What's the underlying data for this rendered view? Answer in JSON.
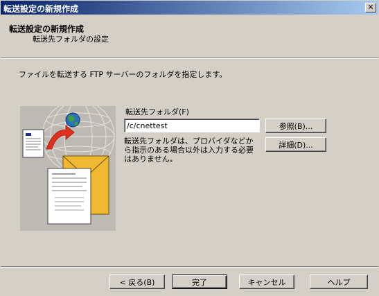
{
  "window": {
    "title": "転送設定の新規作成",
    "close_label": "✕"
  },
  "header": {
    "title": "転送設定の新規作成",
    "subtitle": "転送先フォルダの設定"
  },
  "main": {
    "instruction": "ファイルを転送する FTP サーバーのフォルダを指定します。",
    "folder_label": "転送先フォルダ(F)",
    "folder_value": "/c/cnettest",
    "browse_label": "参照(B)...",
    "details_label": "詳細(D)...",
    "note": "転送先フォルダは、プロバイダなどから指示のある場合以外は入力する必要はありません。"
  },
  "footer": {
    "back_label": "< 戻る(B)",
    "finish_label": "完了",
    "cancel_label": "キャンセル",
    "help_label": "ヘルプ"
  },
  "icons": {
    "illustration": "ftp-transfer-illustration",
    "globe": "globe-icon",
    "arrow": "red-curved-arrow-icon",
    "document": "document-icon",
    "folder": "envelope-folder-icon"
  },
  "colors": {
    "dialog_bg": "#d4d0c8",
    "title_gradient_start": "#0a246a",
    "title_gradient_end": "#a6caf0",
    "folder_yellow": "#f0b830",
    "arrow_red": "#e03020"
  }
}
